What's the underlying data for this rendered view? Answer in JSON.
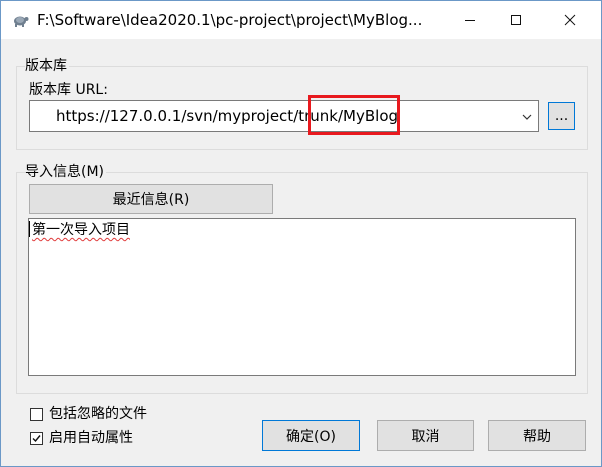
{
  "window": {
    "title": "F:\\Software\\Idea2020.1\\pc-project\\project\\MyBlog...",
    "controls": {
      "minimize_icon": "minimize-icon",
      "maximize_icon": "maximize-icon",
      "close_icon": "close-icon"
    }
  },
  "repository": {
    "group_label": "版本库",
    "url_label": "版本库 URL:",
    "url_value": "https://127.0.0.1/svn/myproject/trunk/MyBlog",
    "browse_label": "..."
  },
  "import_message": {
    "group_label": "导入信息(M)",
    "recent_button": "最近信息(R)",
    "message_text": "第一次导入项目"
  },
  "options": {
    "include_ignored": {
      "label": "包括忽略的文件",
      "checked": false
    },
    "auto_props": {
      "label": "启用自动属性",
      "checked": true
    }
  },
  "buttons": {
    "ok": "确定(O)",
    "cancel": "取消",
    "help": "帮助"
  },
  "colors": {
    "accent": "#0078d7",
    "annotation_red": "#e8191e"
  }
}
